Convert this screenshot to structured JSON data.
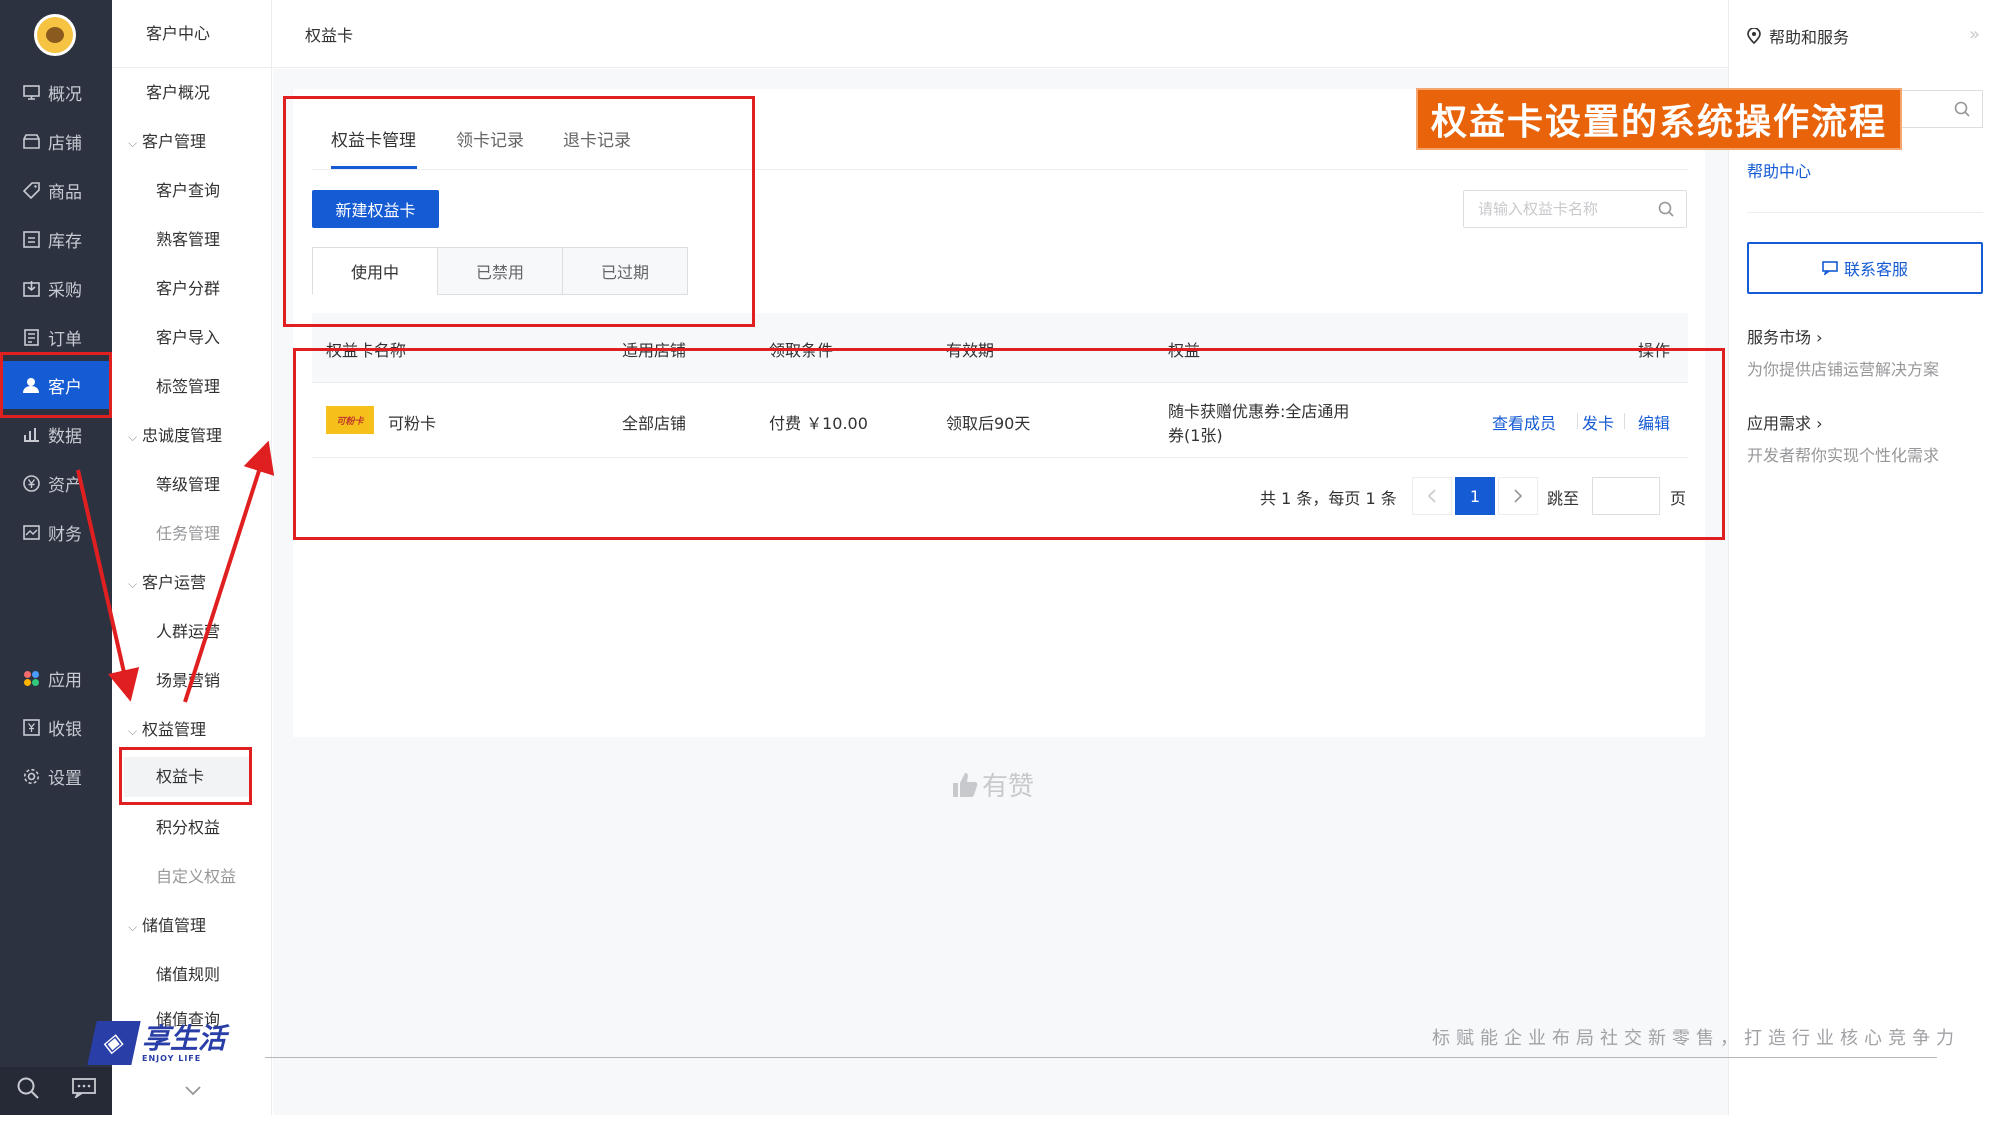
{
  "nav": {
    "items": [
      {
        "label": "概况",
        "icon": "overview-icon"
      },
      {
        "label": "店铺",
        "icon": "store-icon"
      },
      {
        "label": "商品",
        "icon": "tag-icon"
      },
      {
        "label": "库存",
        "icon": "inventory-icon"
      },
      {
        "label": "采购",
        "icon": "purchase-icon"
      },
      {
        "label": "订单",
        "icon": "order-icon"
      },
      {
        "label": "客户",
        "icon": "user-icon"
      },
      {
        "label": "数据",
        "icon": "chart-icon"
      },
      {
        "label": "资产",
        "icon": "yen-icon"
      },
      {
        "label": "财务",
        "icon": "finance-icon"
      },
      {
        "label": "应用",
        "icon": "apps-icon"
      },
      {
        "label": "收银",
        "icon": "cashier-icon"
      },
      {
        "label": "设置",
        "icon": "gear-icon"
      }
    ]
  },
  "subnav": {
    "header": "客户中心",
    "items": [
      "客户概况",
      "客户管理",
      "客户查询",
      "熟客管理",
      "客户分群",
      "客户导入",
      "标签管理",
      "忠诚度管理",
      "等级管理",
      "任务管理",
      "客户运营",
      "人群运营",
      "场景营销",
      "权益管理",
      "权益卡",
      "积分权益",
      "自定义权益",
      "储值管理",
      "储值规则",
      "储值查询"
    ]
  },
  "topbar": {
    "title": "权益卡"
  },
  "tabs": [
    "权益卡管理",
    "领卡记录",
    "退卡记录"
  ],
  "toolbar": {
    "new_button": "新建权益卡",
    "search_placeholder": "请输入权益卡名称"
  },
  "status_tabs": [
    "使用中",
    "已禁用",
    "已过期"
  ],
  "table": {
    "headers": [
      "权益卡名称",
      "适用店铺",
      "领取条件",
      "有效期",
      "权益",
      "操作"
    ],
    "rows": [
      {
        "thumb_text": "可粉卡",
        "name": "可粉卡",
        "store": "全部店铺",
        "condition": "付费 ￥10.00",
        "validity": "领取后90天",
        "benefit_line1": "随卡获赠优惠券:全店通用",
        "benefit_line2": "券(1张)",
        "actions": [
          "查看成员",
          "发卡",
          "编辑"
        ]
      }
    ]
  },
  "pagination": {
    "summary": "共 1 条，每页 1 条",
    "current": "1",
    "jump_label": "跳至",
    "page_unit": "页"
  },
  "footer_logo": "有赞",
  "help": {
    "title": "帮助和服务",
    "collapse": "»",
    "help_center": "帮助中心",
    "contact": "联系客服",
    "market_title": "服务市场 ›",
    "market_desc": "为你提供店铺运营解决方案",
    "demand_title": "应用需求 ›",
    "demand_desc": "开发者帮你实现个性化需求"
  },
  "overlay": {
    "banner": "权益卡设置的系统操作流程",
    "slogan": "标赋能企业布局社交新零售，打造行业核心竞争力",
    "brand_name": "享生活",
    "brand_sub": "ENJOY LIFE"
  },
  "colors": {
    "primary": "#155bd4",
    "nav_bg": "#2d3241",
    "annotation_red": "#e02020",
    "banner_orange": "#e8630a"
  }
}
